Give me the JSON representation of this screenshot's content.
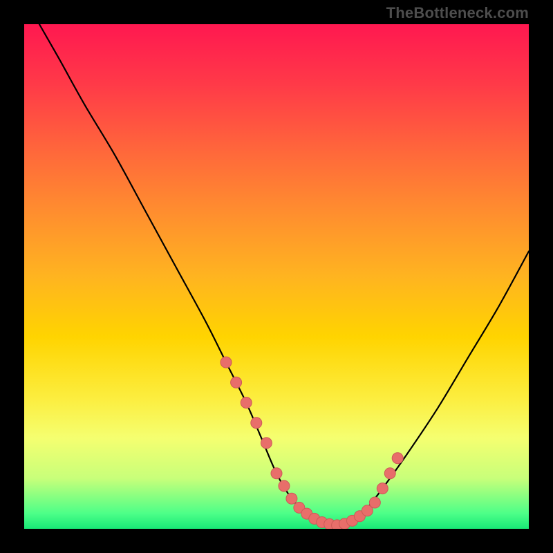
{
  "watermark": "TheBottleneck.com",
  "colors": {
    "frame": "#000000",
    "curve": "#000000",
    "marker_fill": "#e86e6a",
    "marker_stroke": "#cc5a58",
    "gradient_stops": [
      "#ff1850",
      "#ff3a48",
      "#ff6a3a",
      "#ff8a30",
      "#ffb420",
      "#ffd400",
      "#fced3e",
      "#f5ff70",
      "#c8ff7a",
      "#4cff88",
      "#18e876"
    ]
  },
  "chart_data": {
    "type": "line",
    "title": "",
    "xlabel": "",
    "ylabel": "",
    "xlim": [
      0,
      100
    ],
    "ylim": [
      0,
      100
    ],
    "grid": false,
    "legend": false,
    "series": [
      {
        "name": "curve",
        "x": [
          3,
          7,
          12,
          18,
          24,
          30,
          36,
          40,
          44,
          47,
          50,
          53,
          56,
          58,
          60,
          62,
          64,
          67,
          71,
          76,
          82,
          88,
          94,
          100
        ],
        "y": [
          100,
          93,
          84,
          74,
          63,
          52,
          41,
          33,
          25,
          18,
          11,
          6,
          3,
          1.5,
          0.8,
          0.7,
          1.2,
          3,
          8,
          15,
          24,
          34,
          44,
          55
        ]
      }
    ],
    "markers": {
      "name": "dotted-band",
      "x": [
        40,
        42,
        44,
        46,
        48,
        50,
        51.5,
        53,
        54.5,
        56,
        57.5,
        59,
        60.5,
        62,
        63.5,
        65,
        66.5,
        68,
        69.5,
        71,
        72.5,
        74
      ],
      "y": [
        33,
        29,
        25,
        21,
        17,
        11,
        8.5,
        6,
        4.2,
        3,
        2,
        1.3,
        0.9,
        0.7,
        1.0,
        1.6,
        2.5,
        3.6,
        5.2,
        8,
        11,
        14
      ]
    }
  }
}
